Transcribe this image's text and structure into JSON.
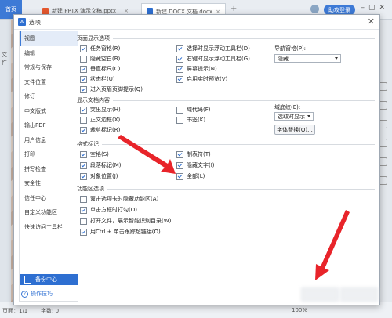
{
  "background": {
    "tabs": [
      {
        "label": "首页"
      },
      {
        "label": "新建 PPTX 演示文稿.pptx"
      },
      {
        "label": "新建 DOCX 文档.docx"
      }
    ],
    "header_button": "助攻登录",
    "side_label": "文件",
    "status": {
      "left": "页面：1/1",
      "middle": "字数: 0",
      "right": "100%"
    }
  },
  "dialog": {
    "title": "选项",
    "nav": [
      {
        "label": "视图",
        "active": true
      },
      {
        "label": "编辑"
      },
      {
        "label": "常规与保存"
      },
      {
        "label": "文件位置"
      },
      {
        "label": "修订"
      },
      {
        "label": "中文版式"
      },
      {
        "label": "输出PDF"
      },
      {
        "label": "用户信息"
      },
      {
        "label": "打印"
      },
      {
        "label": "拼写检查"
      },
      {
        "label": "安全性"
      },
      {
        "label": "信任中心"
      },
      {
        "label": "自定义功能区"
      },
      {
        "label": "快速访问工具栏"
      }
    ],
    "backup_label": "备份中心",
    "tips_label": "操作技巧",
    "page_display": {
      "title": "页面显示选项",
      "col1": [
        {
          "label": "任务窗格(R)",
          "checked": true
        },
        {
          "label": "隐藏空白(B)",
          "checked": false
        },
        {
          "label": "垂直标尺(C)",
          "checked": true
        },
        {
          "label": "状态栏(U)",
          "checked": true
        },
        {
          "label": "进入页眉页脚提示(Q)",
          "checked": true
        }
      ],
      "col2": [
        {
          "label": "选择时显示浮动工具栏(D)",
          "checked": true
        },
        {
          "label": "右键时显示浮动工具栏(G)",
          "checked": true
        },
        {
          "label": "屏幕提示(N)",
          "checked": true
        },
        {
          "label": "启用实时预览(V)",
          "checked": true
        }
      ],
      "nav_pane_label": "导航窗格(P):",
      "nav_pane_value": "隐藏"
    },
    "show_content": {
      "title": "显示文档内容",
      "col1": [
        {
          "label": "突出显示(H)",
          "checked": true
        },
        {
          "label": "正文边框(X)",
          "checked": false
        },
        {
          "label": "裁剪标记(R)",
          "checked": true
        }
      ],
      "col2": [
        {
          "label": "域代码(F)",
          "checked": false
        },
        {
          "label": "书签(K)",
          "checked": false
        }
      ],
      "shading_label": "域底纹(E):",
      "shading_value": "选取时显示",
      "font_sub_button": "字体替换(O)..."
    },
    "format_marks": {
      "title": "格式标记",
      "col1": [
        {
          "label": "空格(S)",
          "checked": true
        },
        {
          "label": "段落标记(M)",
          "checked": true
        },
        {
          "label": "对象位置(J)",
          "checked": true
        }
      ],
      "col2": [
        {
          "label": "制表符(T)",
          "checked": true
        },
        {
          "label": "隐藏文字(I)",
          "checked": true
        },
        {
          "label": "全部(L)",
          "checked": true
        }
      ]
    },
    "ribbon": {
      "title": "功能区选项",
      "items": [
        {
          "label": "双击选项卡时隐藏功能区(A)",
          "checked": false
        },
        {
          "label": "单击方框时打勾(O)",
          "checked": true
        },
        {
          "label": "打开文件，展示智能识别目录(W)",
          "checked": false
        },
        {
          "label": "用Ctrl + 单击跟踪超链接(O)",
          "checked": true
        }
      ]
    },
    "annotation_color": "#e8242a"
  }
}
